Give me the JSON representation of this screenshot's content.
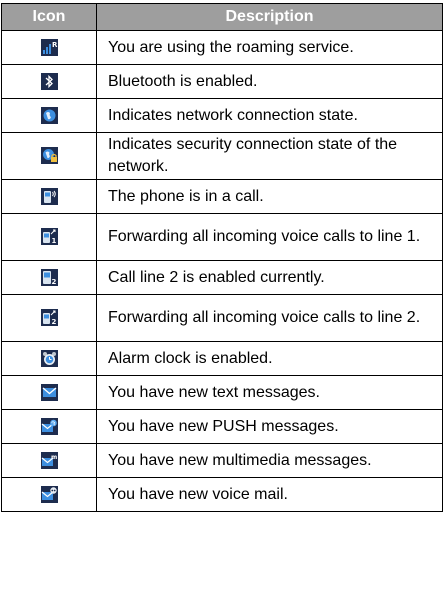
{
  "table": {
    "headers": [
      "Icon",
      "Description"
    ],
    "rows": [
      {
        "icon": "roaming-signal-icon",
        "description": "You are using the roaming service."
      },
      {
        "icon": "bluetooth-icon",
        "description": "Bluetooth is enabled."
      },
      {
        "icon": "network-globe-icon",
        "description": "Indicates network connection state."
      },
      {
        "icon": "secure-network-globe-icon",
        "description": "Indicates security connection state of the network."
      },
      {
        "icon": "phone-in-call-icon",
        "description": "The phone is in a call."
      },
      {
        "icon": "forward-line1-icon",
        "description": "Forwarding all incoming voice calls to line 1."
      },
      {
        "icon": "call-line2-icon",
        "description": "Call line 2 is enabled currently."
      },
      {
        "icon": "forward-line2-icon",
        "description": "Forwarding all incoming voice calls to line 2."
      },
      {
        "icon": "alarm-clock-icon",
        "description": "Alarm clock is enabled."
      },
      {
        "icon": "text-message-icon",
        "description": "You have new text messages."
      },
      {
        "icon": "push-message-icon",
        "description": "You have new PUSH messages."
      },
      {
        "icon": "multimedia-message-icon",
        "description": "You have new multimedia messages."
      },
      {
        "icon": "voice-mail-icon",
        "description": "You have new voice mail."
      }
    ]
  },
  "colors": {
    "header_bg": "#9e9e9e",
    "icon_bg": "#1d2c4e",
    "icon_blue": "#3d8fe0"
  }
}
